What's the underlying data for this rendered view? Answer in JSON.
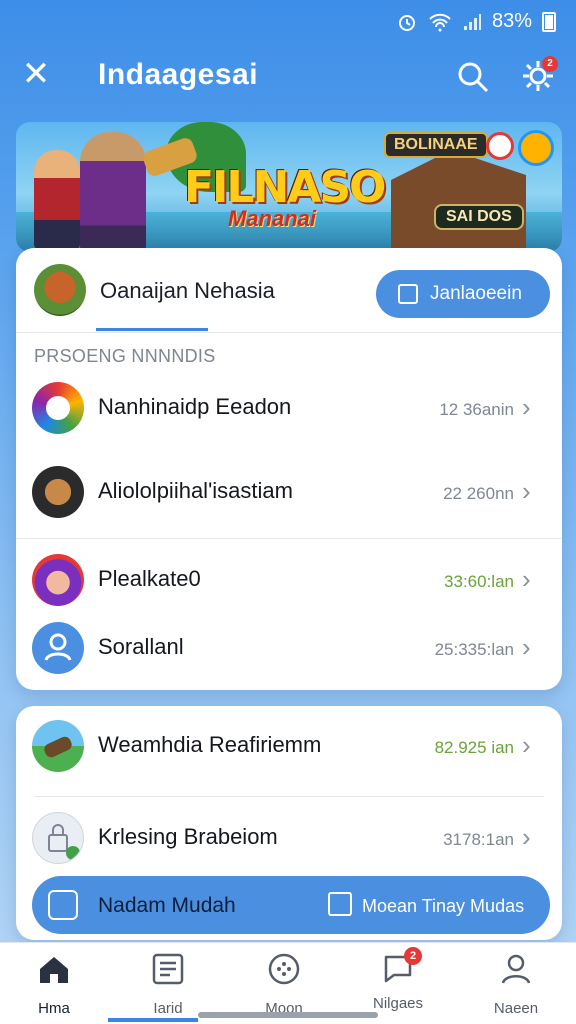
{
  "status_bar": {
    "battery": "83%",
    "icons": [
      "alarm-icon",
      "wifi-icon",
      "signal-icon",
      "battery-icon"
    ]
  },
  "app_bar": {
    "title": "Indaagesai",
    "settings_badge": "2",
    "icons": [
      "close-icon",
      "search-icon",
      "gear-icon"
    ]
  },
  "banner": {
    "logo_line1": "FILNASO",
    "logo_line2": "Mananai",
    "chip_top": "BOLINAAE",
    "chip_bottom": "SAI DOS"
  },
  "profile": {
    "name": "Oanaijan Nehasia",
    "join_label": "Janlaoeein"
  },
  "section": {
    "title": "PRSOENG NNNNDIS"
  },
  "list1": [
    {
      "label": "Nanhinaidp Eeadon",
      "meta": "12 36anin",
      "meta_color": "gray",
      "avatar": "rainbow-app-icon"
    },
    {
      "label": "Aliololpiihal'isastiam",
      "meta": "22 260nn",
      "meta_color": "gray",
      "avatar": "wooden-tool-icon"
    },
    {
      "label": "Plealkate0",
      "meta": "33:60:lan",
      "meta_color": "green",
      "avatar": "clown-face-icon"
    },
    {
      "label": "Sorallanl",
      "meta": "25:335:lan",
      "meta_color": "gray",
      "avatar": "people-icon"
    }
  ],
  "list2": [
    {
      "label": "Weamhdia Reafiriemm",
      "meta": "82.925 ian",
      "meta_color": "green",
      "avatar": "cannon-icon"
    },
    {
      "label": "Krlesing Brabeiom",
      "meta": "3178:1an",
      "meta_color": "gray",
      "avatar": "lock-icon"
    }
  ],
  "action_bar": {
    "left_label": "Nadam Mudah",
    "right_label": "Moean Tinay Mudas"
  },
  "bottom_nav": [
    {
      "label": "Hma",
      "icon": "home-icon",
      "active": true
    },
    {
      "label": "Iarid",
      "icon": "document-icon",
      "active": false
    },
    {
      "label": "Moon",
      "icon": "compass-icon",
      "active": false
    },
    {
      "label": "Nilgaes",
      "icon": "chat-icon",
      "badge": "2",
      "active": false
    },
    {
      "label": "Naeen",
      "icon": "person-icon",
      "active": false
    }
  ],
  "colors": {
    "accent": "#4a8fe0",
    "badge": "#e53935",
    "meta_green": "#6aa33a"
  }
}
